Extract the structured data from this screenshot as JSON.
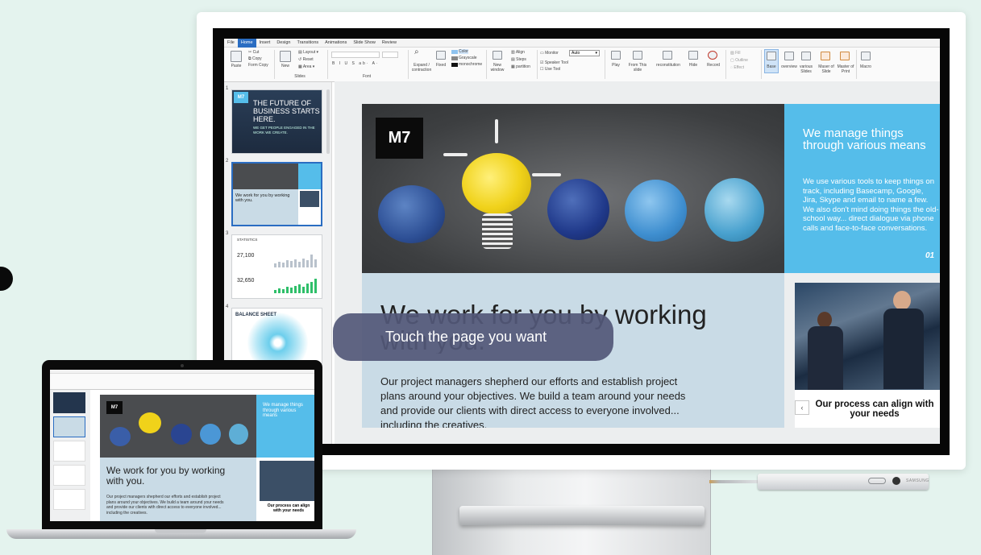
{
  "ribbon": {
    "tabs": [
      "File",
      "Home",
      "Insert",
      "Design",
      "Transitions",
      "Animations",
      "Slide Show",
      "Review"
    ],
    "active_tab": "Home",
    "paste": "Paste",
    "cut": "Cut",
    "copy": "Copy",
    "format_copy": "Form Copy",
    "new_slide": "New",
    "layout": "Layout",
    "reset": "Reset",
    "area": "Area",
    "slides_group": "Slides",
    "font_group": "Font",
    "expand": "Expand / contraction",
    "fixed": "Fixed",
    "color": "Color",
    "grayscale": "Grayscale",
    "monochrome": "monochrome",
    "new_window": "New window",
    "align": "Align",
    "steps": "Steps",
    "partition": "partition",
    "monitor": "Monitor",
    "monitor_value": "Auto",
    "speaker_tool": "Speaker Tool",
    "use_tool": "Use Tool",
    "play": "Play",
    "from_this_slide": "From This slide",
    "reconstitution": "reconstitution",
    "hide": "Hide",
    "record": "Record",
    "fill": "Fill",
    "outline": "Outline",
    "effect": "Effect",
    "base": "Base",
    "overview": "overview",
    "various_slides": "various Slides",
    "master_of_slide": "Maser of Slide",
    "master_of_print": "Master of Print",
    "macro": "Macro"
  },
  "thumbnails": [
    {
      "num": "1",
      "title": "THE FUTURE OF BUSINESS STARTS HERE.",
      "sub": "WE GET PEOPLE ENGAGED IN THE WORK WE CREATE."
    },
    {
      "num": "2",
      "title": "We work for you by working with you."
    },
    {
      "num": "3",
      "label": "STATISTICS",
      "v1": "27,100",
      "v2": "32,650"
    },
    {
      "num": "4",
      "label": "BALANCE SHEET"
    }
  ],
  "slide": {
    "logo": "M7",
    "blue_heading": "We manage things through various means",
    "blue_body": "We use various tools to keep things on track, including Basecamp, Google, Jira, Skype and email to name a few. We also don't mind doing things the old-school way... direct dialogue via phone calls and face-to-face conversations.",
    "blue_number": "01",
    "grey_heading": "We work for you by working with you.",
    "grey_body": "Our project managers shepherd our efforts and establish project plans around your objectives. We build a team around your needs and provide our clients with direct access to everyone involved... including the creatives.",
    "process_caption": "Our process can align with your needs",
    "prev_arrow": "‹"
  },
  "toast": "Touch the page you want",
  "pen_brand": "SAMSUNG",
  "laptop": {
    "heading": "We work for you by working with you.",
    "blue_heading": "We manage things through various means",
    "body": "Our project managers shepherd our efforts and establish project plans around your objectives. We build a team around your needs and provide our clients with direct access to everyone involved... including the creatives.",
    "process_caption": "Our process can align with your needs"
  },
  "colors": {
    "accent_tab": "#2a6dc2",
    "blue_panel": "#55bdea",
    "grey_panel": "#c9dbe6",
    "toast": "#525878"
  }
}
